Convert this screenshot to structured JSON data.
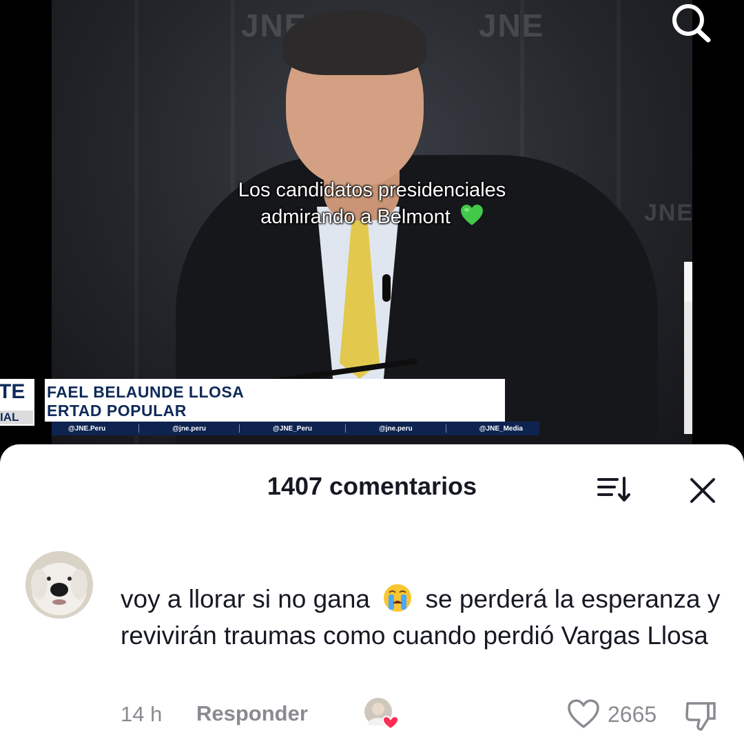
{
  "video": {
    "caption_line1": "Los candidatos presidenciales",
    "caption_line2": "admirando a Belmont",
    "caption_emoji": "green-heart-emoji",
    "lower_third": {
      "left_mark": "TE",
      "left_tag": "IAL",
      "name": "FAEL BELAUNDE LLOSA",
      "party": "ERTAD POPULAR",
      "social": [
        "@JNE.Peru",
        "@jne.peru",
        "@JNE_Peru",
        "@jne.peru",
        "@JNE_Media"
      ]
    },
    "search_icon": "search-icon"
  },
  "comments_sheet": {
    "title": "1407 comentarios",
    "sort_icon": "sort-icon",
    "close_icon": "close-icon",
    "comment": {
      "text_part1": "voy a llorar si no gana",
      "emoji": "crying-face-emoji",
      "text_part2": "se perderá la esperanza y revivirán traumas como cuando perdió Vargas Llosa",
      "time": "14 h",
      "reply_label": "Responder",
      "like_count": "2665",
      "accent_color": "#fe2c55"
    }
  }
}
